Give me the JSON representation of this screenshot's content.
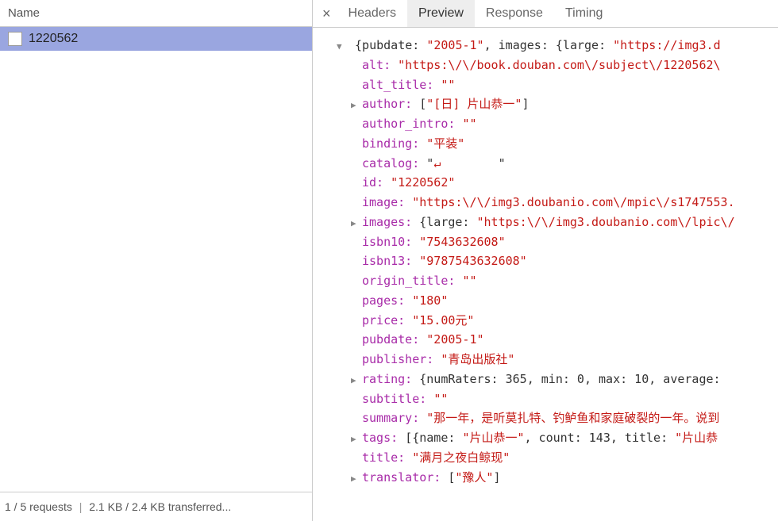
{
  "left": {
    "header": "Name",
    "requests": [
      "1220562"
    ],
    "status": "1 / 5 requests",
    "transferred": "2.1 KB / 2.4 KB transferred..."
  },
  "tabs": {
    "close": "×",
    "headers": "Headers",
    "preview": "Preview",
    "response": "Response",
    "timing": "Timing"
  },
  "preview": {
    "root_prefix": "{pubdate: ",
    "root_pubdate": "\"2005-1\"",
    "root_mid": ", images: {large: ",
    "root_large": "\"https://img3.d",
    "alt_k": "alt: ",
    "alt_v": "\"https:\\/\\/book.douban.com\\/subject\\/1220562\\",
    "alt_title_k": "alt_title: ",
    "alt_title_v": "\"\"",
    "author_k": "author: ",
    "author_v_open": "[",
    "author_v_str": "\"[日] 片山恭一\"",
    "author_v_close": "]",
    "author_intro_k": "author_intro: ",
    "author_intro_v": "\"\"",
    "binding_k": "binding: ",
    "binding_v": "\"平装\"",
    "catalog_k": "catalog: ",
    "catalog_v_q": "\"",
    "catalog_sym": "↵",
    "catalog_end": "\"",
    "id_k": "id: ",
    "id_v": "\"1220562\"",
    "image_k": "image: ",
    "image_v": "\"https:\\/\\/img3.doubanio.com\\/mpic\\/s1747553.",
    "images_k": "images: ",
    "images_v_open": "{large: ",
    "images_v_str": "\"https:\\/\\/img3.doubanio.com\\/lpic\\/",
    "isbn10_k": "isbn10: ",
    "isbn10_v": "\"7543632608\"",
    "isbn13_k": "isbn13: ",
    "isbn13_v": "\"9787543632608\"",
    "origin_title_k": "origin_title: ",
    "origin_title_v": "\"\"",
    "pages_k": "pages: ",
    "pages_v": "\"180\"",
    "price_k": "price: ",
    "price_v": "\"15.00元\"",
    "pubdate_k": "pubdate: ",
    "pubdate_v": "\"2005-1\"",
    "publisher_k": "publisher: ",
    "publisher_v": "\"青岛出版社\"",
    "rating_k": "rating: ",
    "rating_v": "{numRaters: 365, min: 0, max: 10, average:",
    "subtitle_k": "subtitle: ",
    "subtitle_v": "\"\"",
    "summary_k": "summary: ",
    "summary_v": "\"那一年，是听莫扎特、钓鲈鱼和家庭破裂的一年。说到",
    "tags_k": "tags: ",
    "tags_v_open": "[{name: ",
    "tags_v_name": "\"片山恭一\"",
    "tags_v_mid": ", count: 143, title: ",
    "tags_v_title": "\"片山恭",
    "title_k": "title: ",
    "title_v": "\"满月之夜白鲸现\"",
    "translator_k": "translator: ",
    "translator_v_open": "[",
    "translator_v_str": "\"豫人\"",
    "translator_v_close": "]"
  }
}
